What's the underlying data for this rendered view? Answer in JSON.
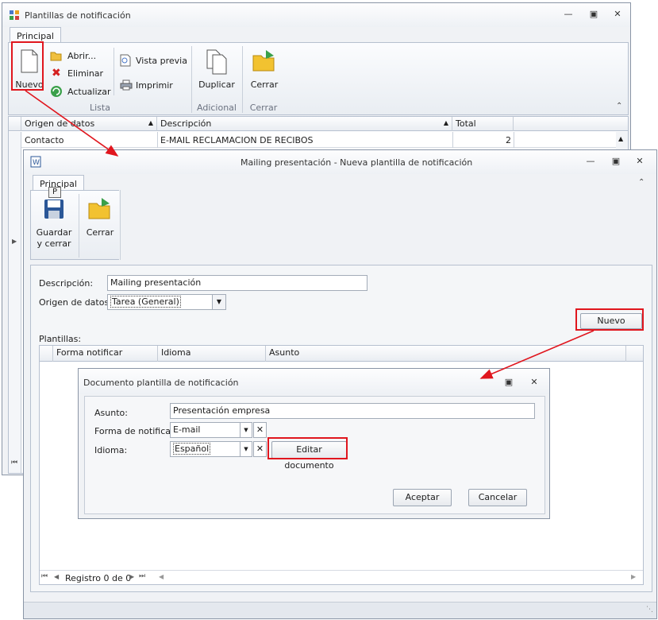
{
  "back_window": {
    "title": "Plantillas de notificación",
    "tab": "Principal",
    "buttons": {
      "nuevo": "Nuevo",
      "abrir": "Abrir...",
      "eliminar": "Eliminar",
      "actualizar": "Actualizar",
      "vista_previa": "Vista previa",
      "imprimir": "Imprimir",
      "duplicar": "Duplicar",
      "cerrar": "Cerrar"
    },
    "groups": {
      "lista": "Lista",
      "adicional": "Adicional",
      "cerrar": "Cerrar"
    },
    "grid": {
      "columns": [
        "Origen de datos",
        "Descripción",
        "Total"
      ],
      "rows": [
        {
          "origen": "Contacto",
          "descripcion": "E-MAIL RECLAMACION DE RECIBOS",
          "total": "2"
        }
      ]
    }
  },
  "front_window": {
    "title": "Mailing presentación - Nueva plantilla de notificación",
    "tab": "Principal",
    "keytip": "P",
    "buttons": {
      "guardar_cerrar": "Guardar y cerrar",
      "cerrar": "Cerrar",
      "nuevo": "Nuevo"
    },
    "form": {
      "descripcion_label": "Descripción:",
      "descripcion_value": "Mailing presentación",
      "origen_label": "Origen de datos:",
      "origen_value": "Tarea (General)"
    },
    "plantillas_label": "Plantillas:",
    "grid_columns": [
      "Forma notificar",
      "Idioma",
      "Asunto"
    ],
    "nav_record": "Registro 0 de 0"
  },
  "dialog": {
    "title": "Documento plantilla de notificación",
    "asunto_label": "Asunto:",
    "asunto_value": "Presentación empresa",
    "forma_label": "Forma de notificar:",
    "forma_value": "E-mail",
    "idioma_label": "Idioma:",
    "idioma_value": "Español",
    "editar_button": "Editar documento",
    "aceptar_button": "Aceptar",
    "cancelar_button": "Cancelar"
  },
  "colors": {
    "highlight_red": "#e0161e",
    "title_bar": "#eef1f5",
    "window_bg": "#f0f2f5"
  }
}
